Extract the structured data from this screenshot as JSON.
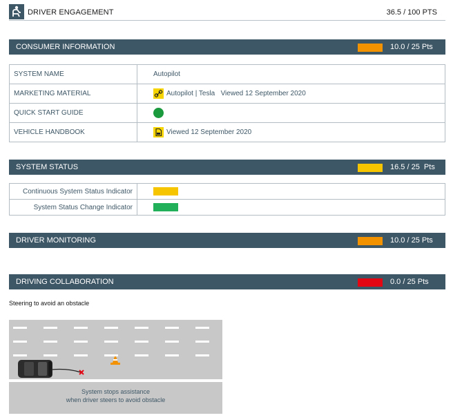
{
  "header": {
    "title": "DRIVER ENGAGEMENT",
    "score": "36.5 / 100 PTS",
    "icon": "seated-driver-icon"
  },
  "consumer_information": {
    "title": "CONSUMER INFORMATION",
    "score": "10.0 / 25 Pts",
    "color": "#f39200",
    "rows": [
      {
        "label": "SYSTEM NAME",
        "value": "Autopilot"
      },
      {
        "label": "MARKETING MATERIAL",
        "value": "Autopilot | Tesla   Viewed 12 September 2020",
        "icon": "link-icon"
      },
      {
        "label": "QUICK START GUIDE",
        "value": "",
        "status_color": "#1a9a3c"
      },
      {
        "label": "VEHICLE HANDBOOK",
        "value": "Viewed 12 September 2020",
        "icon": "document-icon"
      }
    ]
  },
  "system_status": {
    "title": "SYSTEM STATUS",
    "score": "16.5 / 25  Pts",
    "color": "#f7c500",
    "rows": [
      {
        "label": "Continuous System Status Indicator",
        "color": "#f7c500"
      },
      {
        "label": "System Status Change Indicator",
        "color": "#22b05a"
      }
    ]
  },
  "driver_monitoring": {
    "title": "DRIVER MONITORING",
    "score": "10.0 / 25 Pts",
    "color": "#f39200"
  },
  "driving_collaboration": {
    "title": "DRIVING COLLABORATION",
    "score": "0.0 / 25 Pts",
    "color": "#e30613"
  },
  "scenario": {
    "caption": "Steering to avoid an obstacle",
    "illustration_text_line1": "System stops assistance",
    "illustration_text_line2": "when driver steers to avoid obstacle"
  }
}
